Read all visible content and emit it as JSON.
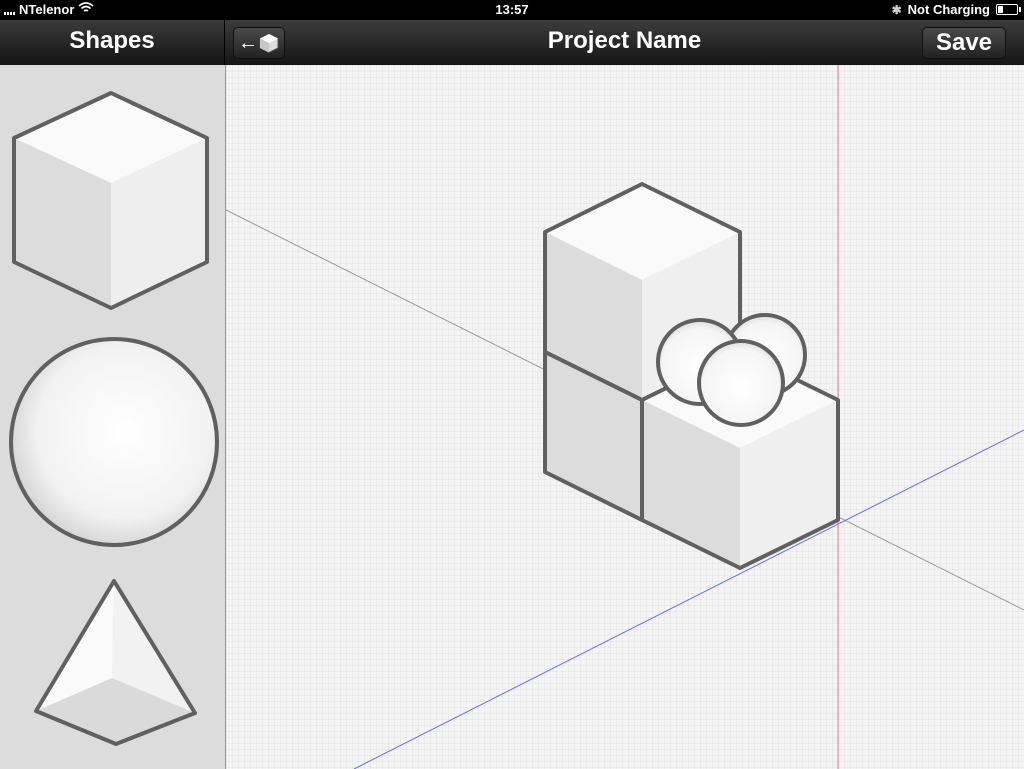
{
  "status_bar": {
    "carrier": "NTelenor",
    "time": "13:57",
    "charging": "Not Charging"
  },
  "sidebar": {
    "title": "Shapes",
    "items": [
      {
        "icon": "cube-icon"
      },
      {
        "icon": "sphere-icon"
      },
      {
        "icon": "pyramid-icon"
      }
    ]
  },
  "toolbar": {
    "project_name": "Project Name",
    "save_label": "Save",
    "back_icon": "back-to-cube-icon"
  },
  "colors": {
    "outline": "#606060",
    "x_axis": "#9a9a9a",
    "y_axis": "#5a5aff",
    "z_axis": "#ff5a7a"
  },
  "battery_level": 0.3
}
